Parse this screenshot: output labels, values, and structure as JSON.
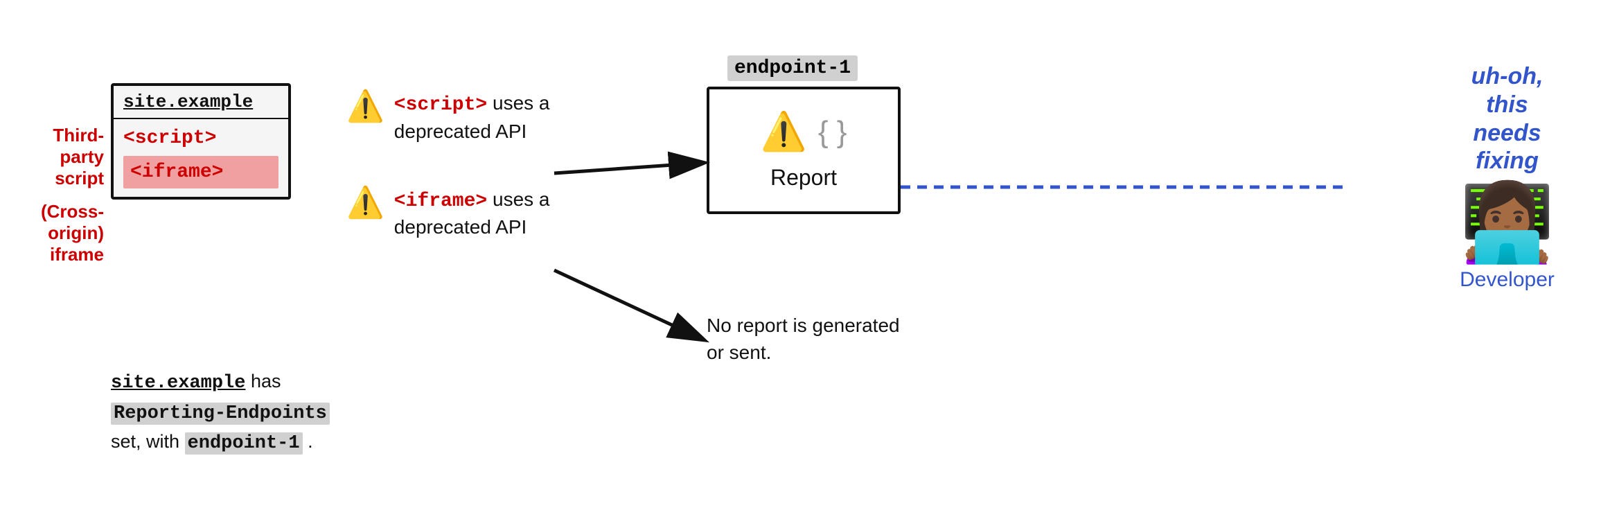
{
  "site_box": {
    "title": "site.example",
    "script_tag": "<script>",
    "iframe_tag": "<iframe>"
  },
  "labels": {
    "third_party": "Third-party script",
    "cross_origin": "(Cross-origin) iframe"
  },
  "warnings": [
    {
      "icon": "⚠️",
      "text_before": "",
      "tag": "<script>",
      "text_after": " uses a deprecated API"
    },
    {
      "icon": "⚠️",
      "text_before": "",
      "tag": "<iframe>",
      "text_after": " uses a deprecated API"
    }
  ],
  "bottom_desc": {
    "line1_mono": "site.example",
    "line1_rest": " has",
    "line2_mono": "Reporting-Endpoints",
    "line3_rest": "set, with ",
    "endpoint_inline": "endpoint-1",
    "line3_end": " ."
  },
  "endpoint": {
    "label": "endpoint-1",
    "report_label": "Report"
  },
  "no_report": "No report is\ngenerated or sent.",
  "developer": {
    "uh_oh": "uh-oh,\nthis\nneeds\nfixing",
    "emoji": "👩🏾‍💻",
    "label": "Developer"
  }
}
